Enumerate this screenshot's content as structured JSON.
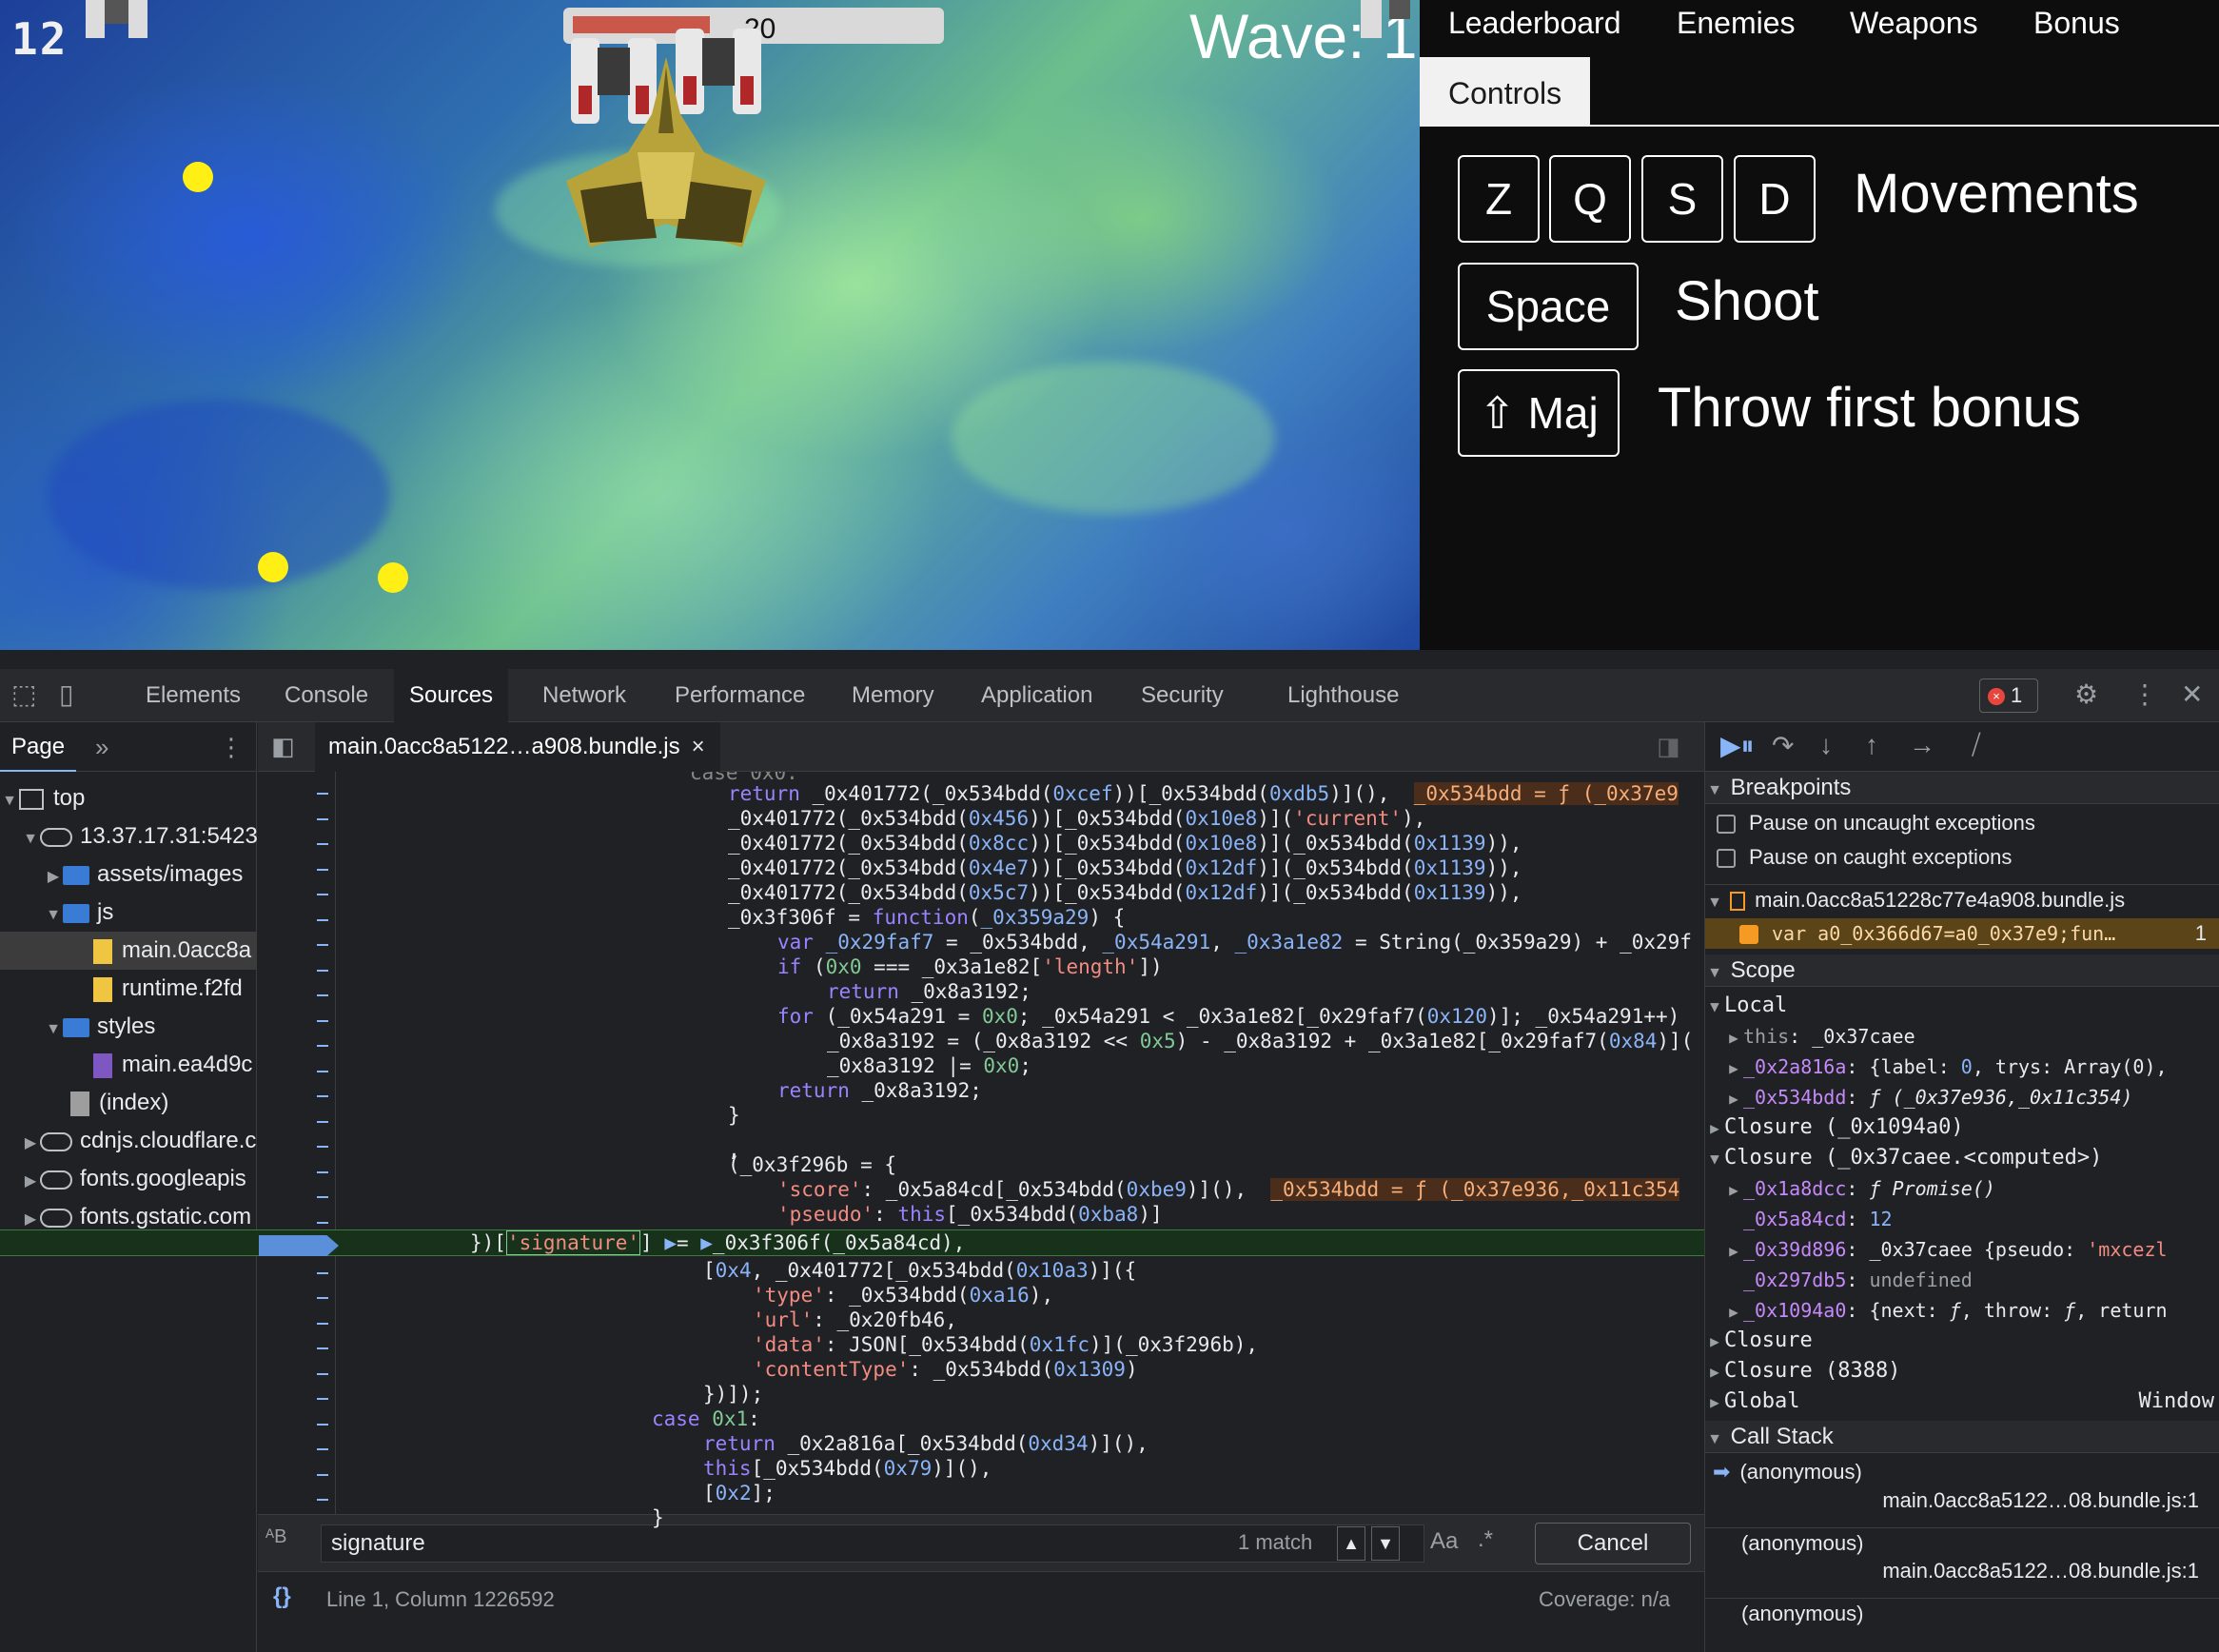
{
  "game": {
    "score": "12",
    "health_value": "20",
    "health_fraction": 0.38,
    "wave_label": "Wave: 1"
  },
  "panel": {
    "tabs": [
      "Leaderboard",
      "Enemies",
      "Weapons",
      "Bonus",
      "Controls"
    ],
    "active_tab": "Controls",
    "controls": {
      "movement_keys": [
        "Z",
        "Q",
        "S",
        "D"
      ],
      "movement_label": "Movements",
      "shoot_key": "Space",
      "shoot_label": "Shoot",
      "bonus_key": "⇧ Maj",
      "bonus_label": "Throw first bonus"
    }
  },
  "devtools": {
    "tabs": [
      "Elements",
      "Console",
      "Sources",
      "Network",
      "Performance",
      "Memory",
      "Application",
      "Security",
      "Lighthouse"
    ],
    "active_tab": "Sources",
    "error_count": "1",
    "navigator": {
      "tab": "Page",
      "more": "»",
      "tree": [
        {
          "label": "top",
          "icon": "frame"
        },
        {
          "label": "13.37.17.31:5423",
          "icon": "cloud"
        },
        {
          "label": "assets/images",
          "icon": "folder"
        },
        {
          "label": "js",
          "icon": "folder"
        },
        {
          "label": "main.0acc8a",
          "icon": "file-js"
        },
        {
          "label": "runtime.f2fd",
          "icon": "file-js"
        },
        {
          "label": "styles",
          "icon": "folder"
        },
        {
          "label": "main.ea4d9c",
          "icon": "file-css"
        },
        {
          "label": "(index)",
          "icon": "file-doc"
        },
        {
          "label": "cdnjs.cloudflare.c",
          "icon": "cloud"
        },
        {
          "label": "fonts.googleapis",
          "icon": "cloud"
        },
        {
          "label": "fonts.gstatic.com",
          "icon": "cloud"
        }
      ]
    },
    "editor": {
      "file_tab": "main.0acc8a5122…a908.bundle.js",
      "search_query": "signature",
      "match_count": "1 match",
      "case_toggle": "Aa",
      "regex_toggle": ".*",
      "cancel_label": "Cancel",
      "status_position": "Line 1, Column 1226592",
      "coverage": "Coverage: n/a",
      "format_icon": "{}"
    },
    "debugger": {
      "breakpoints_title": "Breakpoints",
      "pause_uncaught": "Pause on uncaught exceptions",
      "pause_caught": "Pause on caught exceptions",
      "bp_file": "main.0acc8a51228c77e4a908.bundle.js",
      "bp_line_code": "var a0_0x366d67=a0_0x37e9;fun…",
      "bp_line_number": "1",
      "scope_title": "Scope",
      "local_title": "Local",
      "call_stack_title": "Call Stack",
      "call_stack_fn": "(anonymous)",
      "call_stack_loc": "main.0acc8a5122…08.bundle.js:1",
      "global_value": "Window"
    }
  }
}
